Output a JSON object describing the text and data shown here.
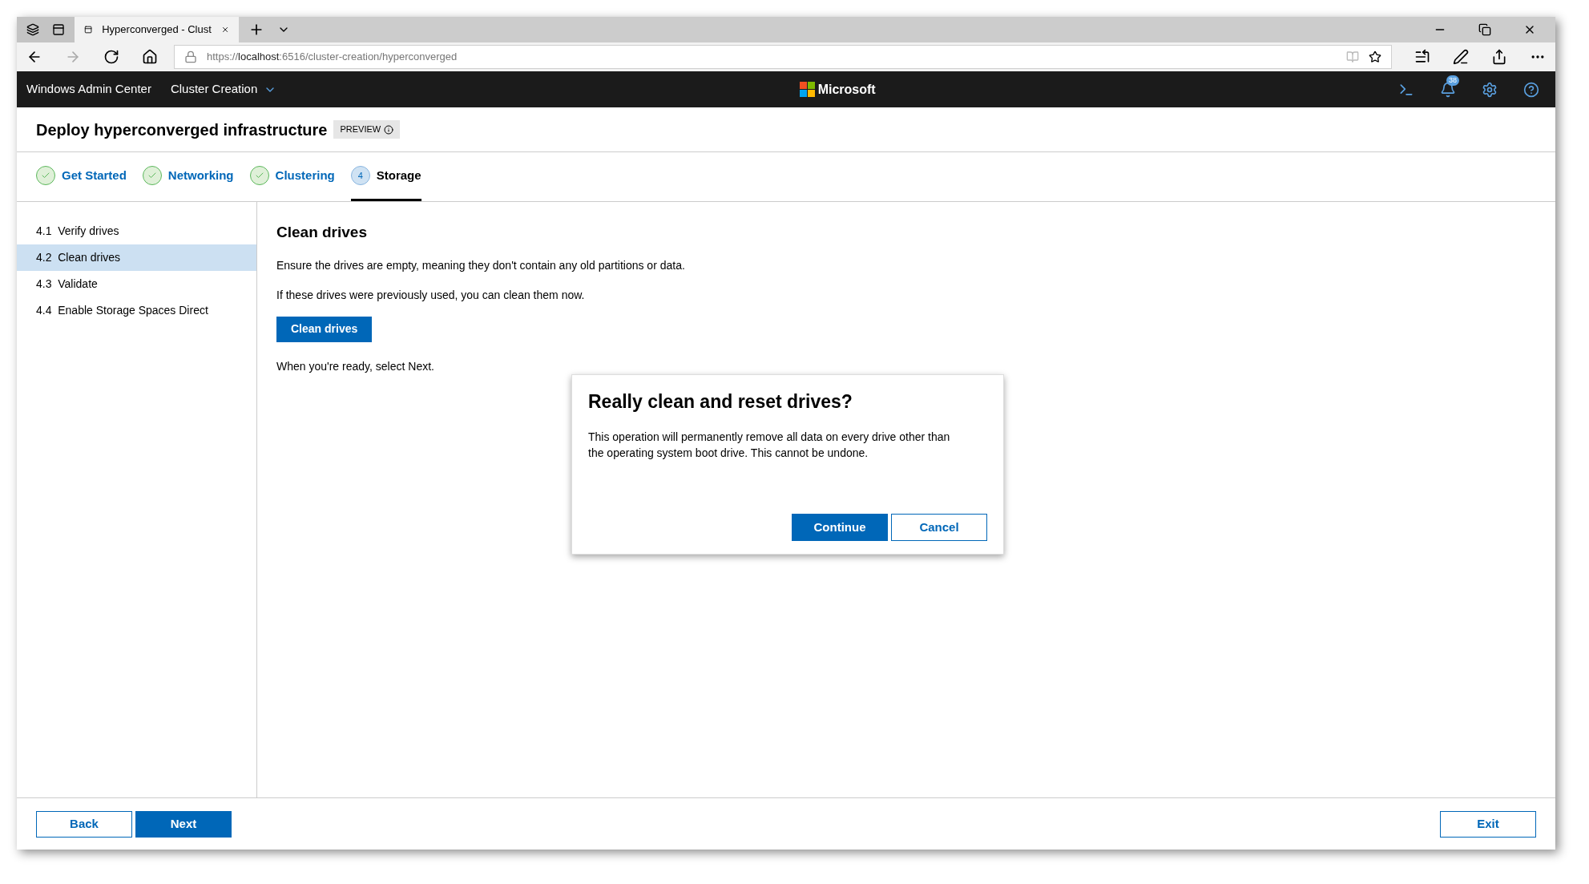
{
  "browser": {
    "tab_title": "Hyperconverged - Clust",
    "url_prefix": "https://",
    "url_host": "localhost",
    "url_rest": ":6516/cluster-creation/hyperconverged"
  },
  "app_bar": {
    "app_name": "Windows Admin Center",
    "menu": "Cluster Creation",
    "brand": "Microsoft",
    "notification_count": "38"
  },
  "header": {
    "title": "Deploy hyperconverged infrastructure",
    "badge": "PREVIEW"
  },
  "steps": [
    {
      "label": "Get Started",
      "kind": "done",
      "selected": false
    },
    {
      "label": "Networking",
      "kind": "done",
      "selected": false
    },
    {
      "label": "Clustering",
      "kind": "done",
      "selected": false
    },
    {
      "label": "Storage",
      "kind": "current",
      "number": "4",
      "selected": true
    }
  ],
  "sidebar": {
    "items": [
      {
        "number": "4.1",
        "label": "Verify drives",
        "selected": false
      },
      {
        "number": "4.2",
        "label": "Clean drives",
        "selected": true
      },
      {
        "number": "4.3",
        "label": "Validate",
        "selected": false
      },
      {
        "number": "4.4",
        "label": "Enable Storage Spaces Direct",
        "selected": false
      }
    ]
  },
  "content": {
    "title": "Clean drives",
    "paragraphs": [
      "Ensure the drives are empty, meaning they don't contain any old partitions or data.",
      "If these drives were previously used, you can clean them now."
    ],
    "button": "Clean drives",
    "footer_text": "When you're ready, select Next."
  },
  "dialog": {
    "title": "Really clean and reset drives?",
    "message": "This operation will permanently remove all data on every drive other than the operating system boot drive. This cannot be undone.",
    "buttons": [
      {
        "label": "Continue",
        "kind": "primary"
      },
      {
        "label": "Cancel",
        "kind": "secondary"
      }
    ]
  },
  "footer": {
    "buttons": [
      {
        "label": "Back",
        "kind": "secondary"
      },
      {
        "label": "Next",
        "kind": "primary"
      }
    ],
    "exit": "Exit"
  }
}
